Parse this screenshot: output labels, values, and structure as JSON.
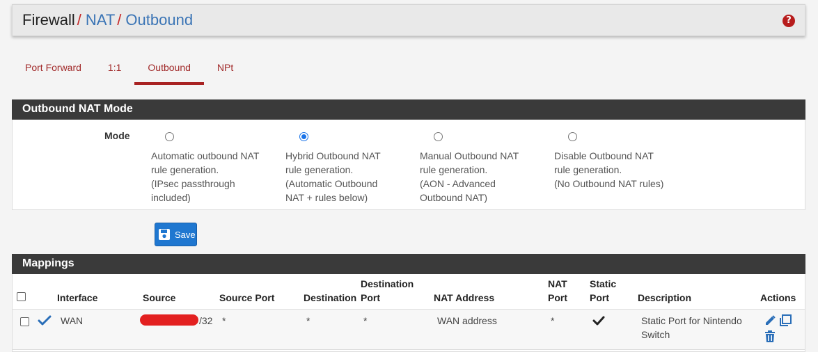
{
  "breadcrumb": {
    "first": "Firewall",
    "second": "NAT",
    "third": "Outbound",
    "separator": "/",
    "help_icon": "question-circle-icon"
  },
  "tabs": [
    {
      "label": "Port Forward",
      "active": false
    },
    {
      "label": "1:1",
      "active": false
    },
    {
      "label": "Outbound",
      "active": true
    },
    {
      "label": "NPt",
      "active": false
    }
  ],
  "mode_panel": {
    "title": "Outbound NAT Mode",
    "mode_label": "Mode",
    "options": [
      {
        "text": "Automatic outbound NAT\nrule generation.\n(IPsec passthrough\nincluded)",
        "checked": false
      },
      {
        "text": "Hybrid Outbound NAT\nrule generation.\n(Automatic Outbound\nNAT + rules below)",
        "checked": true
      },
      {
        "text": "Manual Outbound NAT\nrule generation.\n(AON - Advanced\nOutbound NAT)",
        "checked": false
      },
      {
        "text": "Disable Outbound NAT\nrule generation.\n(No Outbound NAT rules)",
        "checked": false
      }
    ]
  },
  "save": {
    "label": "Save",
    "icon": "floppy-disk-icon",
    "color": "#1f77d0"
  },
  "mappings": {
    "title": "Mappings",
    "headers": {
      "interface": "Interface",
      "source": "Source",
      "source_port": "Source Port",
      "destination": "Destination",
      "destination_port": "Destination\nPort",
      "nat_address": "NAT Address",
      "nat_port": "NAT\nPort",
      "static_port": "Static\nPort",
      "description": "Description",
      "actions": "Actions"
    },
    "rows": [
      {
        "enabled_icon": "check-icon",
        "interface": "WAN",
        "source_suffix": "/32",
        "source_port": "*",
        "destination": "*",
        "destination_port": "*",
        "nat_address": "WAN address",
        "nat_port": "*",
        "static_port_icon": "check-icon",
        "description": "Static Port for Nintendo\nSwitch",
        "action_icons": [
          "pencil-icon",
          "copy-icon",
          "trash-icon"
        ]
      }
    ]
  },
  "colors": {
    "accent_red": "#a82222",
    "link_blue": "#3a74b5",
    "header_dark": "#3a3a3a"
  }
}
